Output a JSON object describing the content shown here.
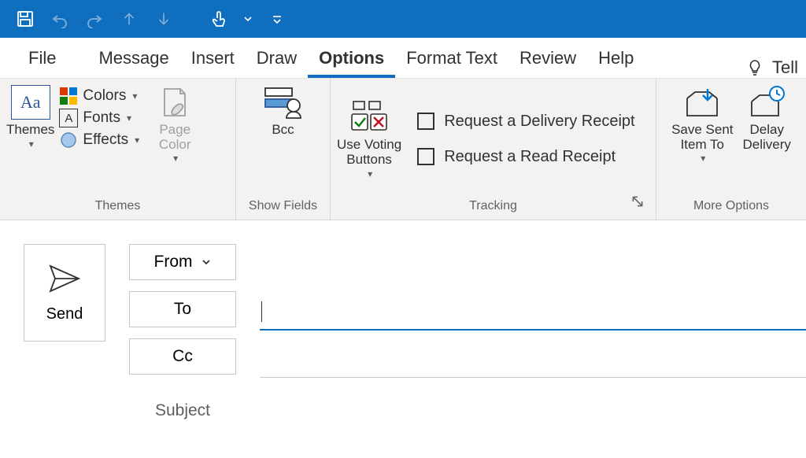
{
  "qat": {
    "save": "save",
    "undo": "undo",
    "redo": "redo",
    "up": "up",
    "down": "down",
    "touch": "touch",
    "dropdown": "dropdown",
    "customize": "customize"
  },
  "tabs": {
    "file": "File",
    "items": [
      {
        "label": "Message"
      },
      {
        "label": "Insert"
      },
      {
        "label": "Draw"
      },
      {
        "label": "Options",
        "active": true
      },
      {
        "label": "Format Text"
      },
      {
        "label": "Review"
      },
      {
        "label": "Help"
      }
    ],
    "tell_me": "Tell"
  },
  "ribbon": {
    "themes": {
      "group_label": "Themes",
      "themes_btn": "Themes",
      "colors": "Colors",
      "fonts": "Fonts",
      "effects": "Effects",
      "page_color": "Page\nColor"
    },
    "show_fields": {
      "group_label": "Show Fields",
      "bcc": "Bcc"
    },
    "tracking": {
      "group_label": "Tracking",
      "voting": "Use Voting\nButtons",
      "delivery_receipt": "Request a Delivery Receipt",
      "read_receipt": "Request a Read Receipt"
    },
    "more_options": {
      "group_label": "More Options",
      "save_sent": "Save Sent\nItem To",
      "delay": "Delay\nDelivery"
    }
  },
  "compose": {
    "send": "Send",
    "from": "From",
    "to": "To",
    "cc": "Cc",
    "subject": "Subject"
  }
}
